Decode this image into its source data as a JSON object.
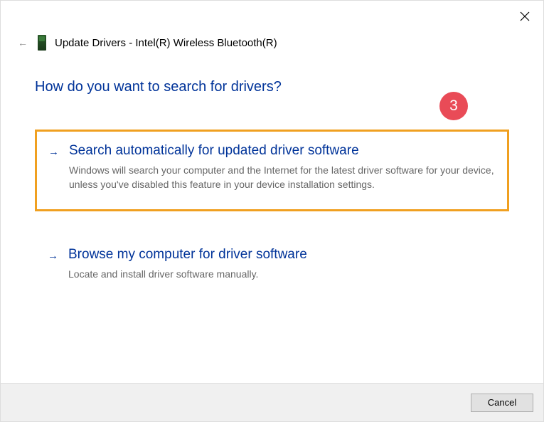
{
  "header": {
    "title": "Update Drivers - Intel(R) Wireless Bluetooth(R)"
  },
  "question": "How do you want to search for drivers?",
  "options": [
    {
      "title": "Search automatically for updated driver software",
      "description": "Windows will search your computer and the Internet for the latest driver software for your device, unless you've disabled this feature in your device installation settings."
    },
    {
      "title": "Browse my computer for driver software",
      "description": "Locate and install driver software manually."
    }
  ],
  "callout": {
    "number": "3"
  },
  "footer": {
    "cancel_label": "Cancel"
  }
}
